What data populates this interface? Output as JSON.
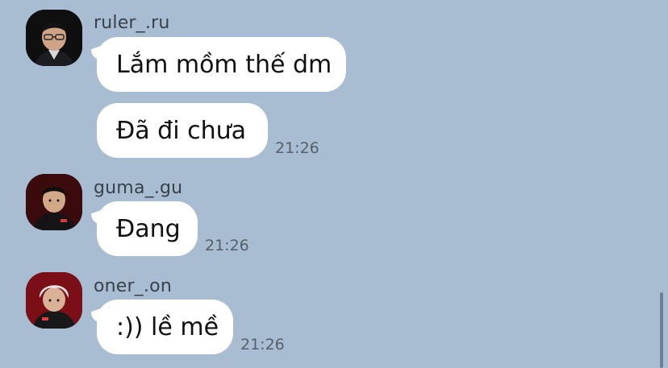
{
  "messages": [
    {
      "sender": "ruler_.ru",
      "bubbles": [
        {
          "text": "Lắm mồm thế dm",
          "time": ""
        },
        {
          "text": "Đã đi chưa",
          "time": "21:26"
        }
      ]
    },
    {
      "sender": "guma_.gu",
      "bubbles": [
        {
          "text": "Đang",
          "time": "21:26"
        }
      ]
    },
    {
      "sender": "oner_.on",
      "bubbles": [
        {
          "text": ":)) lề mề",
          "time": "21:26"
        }
      ]
    }
  ],
  "colors": {
    "background": "#a9bdd2",
    "bubble": "#ffffff"
  }
}
